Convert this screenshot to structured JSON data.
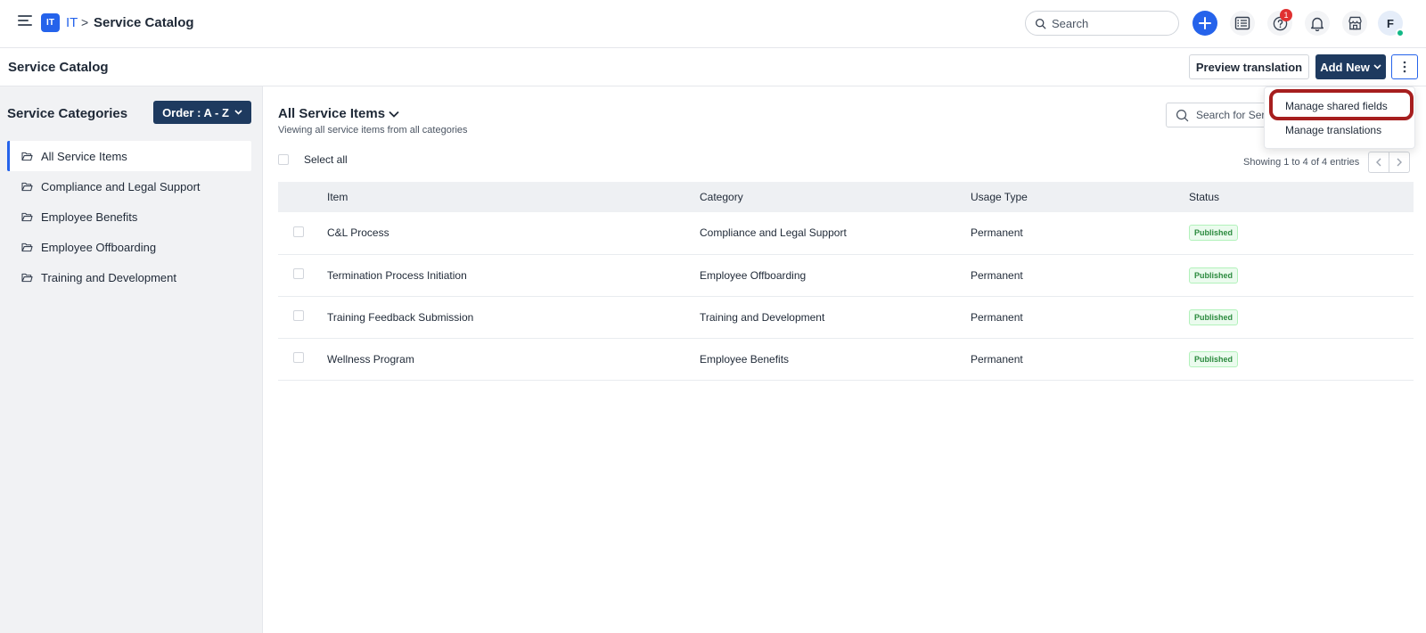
{
  "topbar": {
    "workspace_badge": "IT",
    "workspace_name": "IT",
    "breadcrumb_separator": ">",
    "breadcrumb_title": "Service Catalog",
    "search_placeholder": "Search",
    "notification_count": "1",
    "avatar_initial": "F"
  },
  "header": {
    "title": "Service Catalog",
    "preview_label": "Preview translation",
    "add_new_label": "Add New"
  },
  "sidebar": {
    "title": "Service Categories",
    "order_label": "Order : A - Z",
    "items": [
      {
        "label": "All Service Items",
        "active": true
      },
      {
        "label": "Compliance and Legal Support"
      },
      {
        "label": "Employee Benefits"
      },
      {
        "label": "Employee Offboarding"
      },
      {
        "label": "Training and Development"
      }
    ]
  },
  "main": {
    "title": "All Service Items",
    "subtitle": "Viewing all service items from all categories",
    "search_placeholder": "Search for Service Items",
    "select_all_label": "Select all",
    "showing_text": "Showing 1 to 4 of 4 entries",
    "table": {
      "columns": [
        "Item",
        "Category",
        "Usage Type",
        "Status"
      ],
      "rows": [
        {
          "item": "C&L Process",
          "category": "Compliance and Legal Support",
          "usage": "Permanent",
          "status": "Published"
        },
        {
          "item": "Termination Process Initiation",
          "category": "Employee Offboarding",
          "usage": "Permanent",
          "status": "Published"
        },
        {
          "item": "Training Feedback Submission",
          "category": "Training and Development",
          "usage": "Permanent",
          "status": "Published"
        },
        {
          "item": "Wellness Program",
          "category": "Employee Benefits",
          "usage": "Permanent",
          "status": "Published"
        }
      ]
    }
  },
  "dropdown": {
    "items": [
      "Manage shared fields",
      "Manage translations"
    ]
  },
  "colors": {
    "accent": "#2563eb",
    "navy": "#1e3a5f",
    "highlight": "#a61e1e",
    "published_green": "#2b8a3e"
  }
}
